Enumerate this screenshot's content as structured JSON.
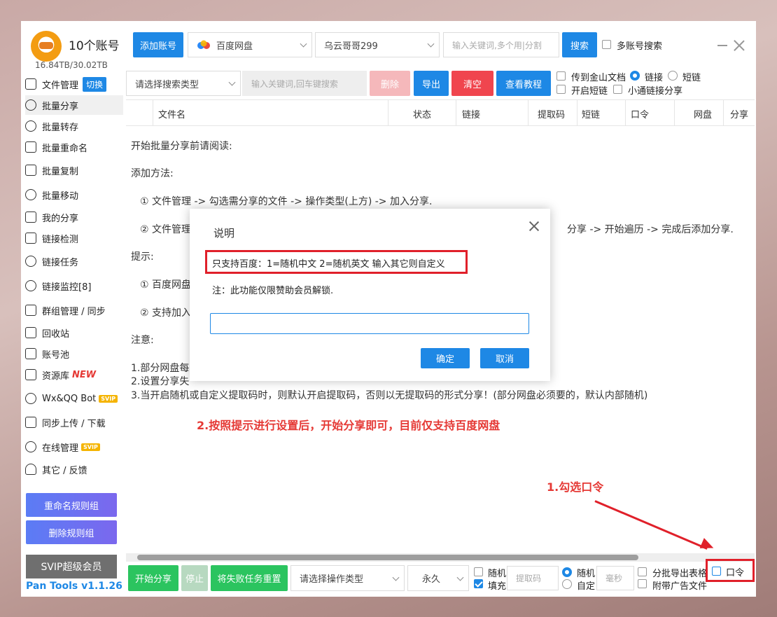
{
  "app": {
    "title": "10个账号",
    "storage": "16.84TB/30.02TB"
  },
  "header": {
    "add_account": "添加账号",
    "cloud_select": "百度网盘",
    "account_select": "乌云哥哥299",
    "keyword_placeholder": "输入关键词,多个用|分割",
    "search": "搜索",
    "multi_search": "多账号搜索"
  },
  "sidebar": {
    "items": [
      {
        "label": "文件管理",
        "icon": "folder-icon",
        "extra": "切换"
      },
      {
        "label": "批量分享",
        "icon": "share-icon"
      },
      {
        "label": "批量转存",
        "icon": "transfer-icon"
      },
      {
        "label": "批量重命名",
        "icon": "rename-icon"
      },
      {
        "label": "批量复制",
        "icon": "copy-icon"
      },
      {
        "label": "批量移动",
        "icon": "move-icon"
      },
      {
        "label": "我的分享",
        "icon": "my-share-icon"
      },
      {
        "label": "链接检测",
        "icon": "link-check-icon"
      },
      {
        "label": "链接任务",
        "icon": "link-task-icon"
      },
      {
        "label": "链接监控[8]",
        "icon": "link-monitor-icon"
      },
      {
        "label": "群组管理 / 同步",
        "icon": "group-icon"
      },
      {
        "label": "回收站",
        "icon": "trash-icon"
      },
      {
        "label": "账号池",
        "icon": "account-pool-icon"
      },
      {
        "label": "资源库",
        "icon": "resource-icon",
        "badge": "NEW"
      },
      {
        "label": "Wx&QQ Bot",
        "icon": "bot-icon",
        "badge": "SVIP"
      },
      {
        "label": "同步上传 / 下载",
        "icon": "sync-icon"
      },
      {
        "label": "在线管理",
        "icon": "online-icon",
        "badge": "SVIP"
      },
      {
        "label": "其它 / 反馈",
        "icon": "bell-icon"
      }
    ],
    "rename_rules": "重命名规则组",
    "delete_rules": "删除规则组",
    "svip": "SVIP超级会员",
    "version": "Pan Tools v1.1.26"
  },
  "toolbar": {
    "search_type": "请选择搜索类型",
    "search_placeholder": "输入关键词,回车键搜索",
    "delete": "删除",
    "export": "导出",
    "clear": "清空",
    "tutorial": "查看教程",
    "to_jinshan": "传到金山文档",
    "link": "链接",
    "short_link": "短链",
    "enable_short": "开启短链",
    "small_link_share": "小通链接分享"
  },
  "table": {
    "columns": [
      "文件名",
      "状态",
      "链接",
      "提取码",
      "短链",
      "口令",
      "网盘",
      "分享"
    ]
  },
  "content": {
    "lines": [
      "开始批量分享前请阅读:",
      "添加方法:",
      "① 文件管理 -> 勾选需分享的文件 -> 操作类型(上方) -> 加入分享.",
      "② 文件管理",
      "分享 -> 开始遍历 -> 完成后添加分享.",
      "提示:",
      "① 百度网盘",
      "② 支持加入",
      "注意:",
      "1.部分网盘每",
      "2.设置分享失",
      "3.当开启随机或自定义提取码时，则默认开启提取码，否则以无提取码的形式分享！(部分网盘必须要的，默认内部随机)"
    ],
    "annotation_step2": "2.按照提示进行设置后，开始分享即可，目前仅支持百度网盘",
    "annotation_step1": "1.勾选口令"
  },
  "dialog": {
    "title": "说明",
    "message": "只支持百度：1=随机中文 2=随机英文 输入其它则自定义",
    "note": "注：此功能仅限赞助会员解锁.",
    "input_value": "",
    "ok": "确定",
    "cancel": "取消"
  },
  "bottom": {
    "start": "开始分享",
    "stop": "停止",
    "reset_failed": "将失败任务重置",
    "op_type": "请选择操作类型",
    "expire": "永久",
    "random": "随机",
    "fill": "填充",
    "extract_code_placeholder": "提取码",
    "random2": "随机",
    "custom": "自定",
    "ms_placeholder": "毫秒",
    "batch_export": "分批导出表格",
    "with_ad": "附带广告文件",
    "password": "口令"
  },
  "colors": {
    "accent": "#1e88e5",
    "danger": "#f0454e",
    "success": "#2bc45f",
    "annotation": "#e0202a"
  }
}
